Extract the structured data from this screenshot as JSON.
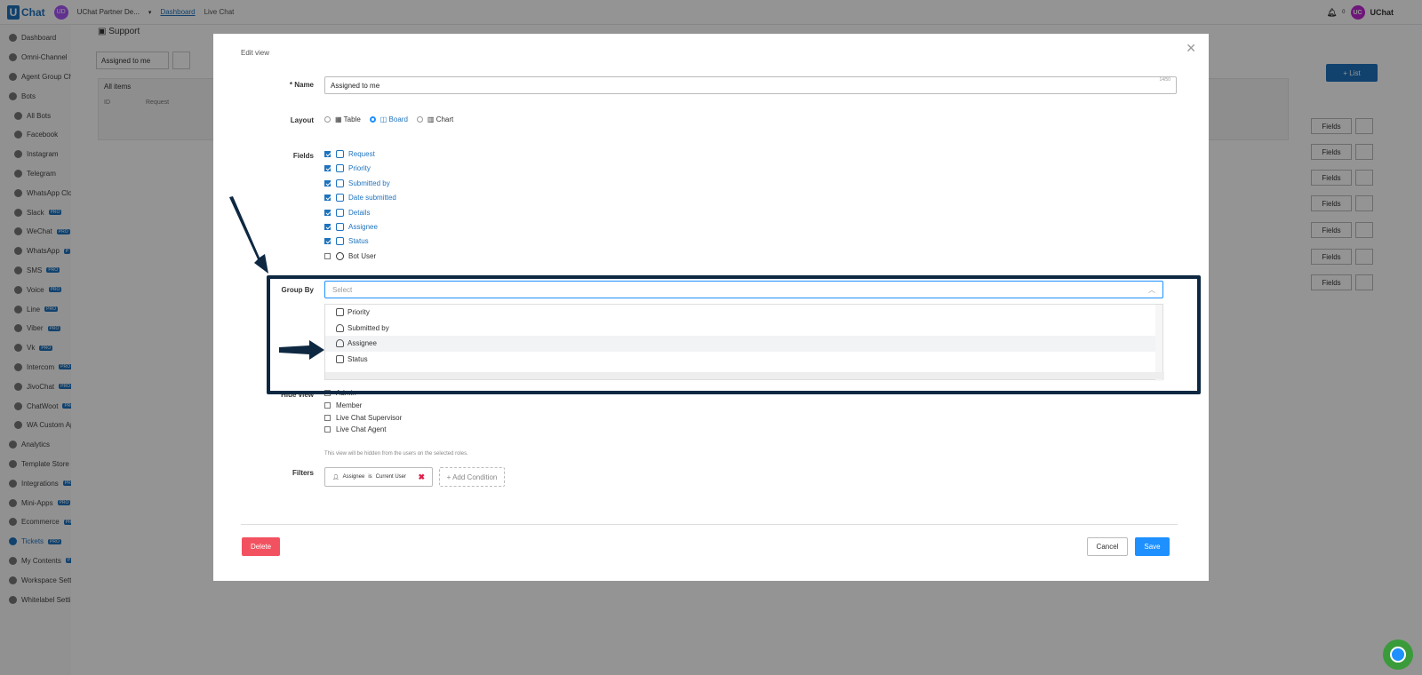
{
  "topbar": {
    "logo_letter": "U",
    "logo_text": "Chat",
    "user_initials": "UD",
    "workspace": "UChat Partner De...",
    "nav_dashboard": "Dashboard",
    "nav_livechat": "Live Chat",
    "notif_count": "0",
    "account_initials": "UC",
    "account_name": "UChat"
  },
  "sidebar": {
    "items": [
      {
        "label": "Dashboard",
        "icon": "dashboard-icon"
      },
      {
        "label": "Omni-Channel",
        "icon": "omnichannel-icon"
      },
      {
        "label": "Agent Group Ch",
        "icon": "agent-group-icon"
      },
      {
        "label": "Bots",
        "icon": "bots-icon"
      },
      {
        "label": "All Bots",
        "icon": "all-bots-icon"
      },
      {
        "label": "Facebook",
        "icon": "facebook-icon"
      },
      {
        "label": "Instagram",
        "icon": "instagram-icon"
      },
      {
        "label": "Telegram",
        "icon": "telegram-icon"
      },
      {
        "label": "WhatsApp Clo",
        "icon": "whatsapp-icon"
      },
      {
        "label": "Slack",
        "icon": "slack-icon",
        "pro": "PRO"
      },
      {
        "label": "WeChat",
        "icon": "wechat-icon",
        "pro": "PRO"
      },
      {
        "label": "WhatsApp",
        "icon": "whatsapp-icon",
        "pro": "P"
      },
      {
        "label": "SMS",
        "icon": "sms-icon",
        "pro": "PRO"
      },
      {
        "label": "Voice",
        "icon": "voice-icon",
        "pro": "PRO"
      },
      {
        "label": "Line",
        "icon": "line-icon",
        "pro": "PRO"
      },
      {
        "label": "Viber",
        "icon": "viber-icon",
        "pro": "PRO"
      },
      {
        "label": "Vk",
        "icon": "vk-icon",
        "pro": "PRO"
      },
      {
        "label": "Intercom",
        "icon": "intercom-icon",
        "pro": "PRO"
      },
      {
        "label": "JivoChat",
        "icon": "jivochat-icon",
        "pro": "PRO"
      },
      {
        "label": "ChatWoot",
        "icon": "chatwoot-icon",
        "pro": "PRO"
      },
      {
        "label": "WA Custom Ap",
        "icon": "wa-custom-icon"
      },
      {
        "label": "Analytics",
        "icon": "analytics-icon"
      },
      {
        "label": "Template Store",
        "icon": "template-store-icon"
      },
      {
        "label": "Integrations",
        "icon": "integrations-icon",
        "pro": "PRO"
      },
      {
        "label": "Mini-Apps",
        "icon": "mini-apps-icon",
        "pro": "PRO"
      },
      {
        "label": "Ecommerce",
        "icon": "ecommerce-icon",
        "pro": "PR"
      },
      {
        "label": "Tickets",
        "icon": "tickets-icon",
        "pro": "PRO",
        "active": true
      },
      {
        "label": "My Contents",
        "icon": "my-contents-icon",
        "pro": "P"
      },
      {
        "label": "Workspace Setti",
        "icon": "workspace-settings-icon"
      },
      {
        "label": "Whitelabel Setti",
        "icon": "whitelabel-settings-icon"
      }
    ]
  },
  "background": {
    "page_title": "Support",
    "view_select": "Assigned to me",
    "all_items": "All items",
    "col_id": "ID",
    "col_request": "Request",
    "list_button": "+ List",
    "fields_button": "Fields"
  },
  "modal": {
    "title": "Edit view",
    "name_label": "* Name",
    "name_value": "Assigned to me",
    "name_counter": "14/50",
    "layout_label": "Layout",
    "layout_options": [
      {
        "label": "Table",
        "selected": false
      },
      {
        "label": "Board",
        "selected": true
      },
      {
        "label": "Chart",
        "selected": false
      }
    ],
    "fields_label": "Fields",
    "fields": [
      {
        "label": "Request",
        "checked": true
      },
      {
        "label": "Priority",
        "checked": true
      },
      {
        "label": "Submitted by",
        "checked": true
      },
      {
        "label": "Date submitted",
        "checked": true
      },
      {
        "label": "Details",
        "checked": true
      },
      {
        "label": "Assignee",
        "checked": true
      },
      {
        "label": "Status",
        "checked": true
      },
      {
        "label": "Bot User",
        "checked": false
      }
    ],
    "groupby_label": "Group By",
    "groupby_placeholder": "Select",
    "groupby_options": [
      {
        "label": "Priority",
        "icon": "dropdown-field-icon"
      },
      {
        "label": "Submitted by",
        "icon": "user-icon"
      },
      {
        "label": "Assignee",
        "icon": "user-icon",
        "hover": true
      },
      {
        "label": "Status",
        "icon": "dropdown-field-icon"
      }
    ],
    "hideview_label": "Hide view",
    "roles": [
      "Admin",
      "Member",
      "Live Chat Supervisor",
      "Live Chat Agent"
    ],
    "hide_hint": "This view will be hidden from the users on the selected roles.",
    "filters_label": "Filters",
    "filter_field": "Assignee",
    "filter_op": "is",
    "filter_value": "Current User",
    "add_condition": "+ Add Condition",
    "delete_button": "Delete",
    "cancel_button": "Cancel",
    "save_button": "Save"
  },
  "colors": {
    "accent": "#1e73be",
    "primary_button": "#1e90ff",
    "danger": "#f25260",
    "highlight_frame": "#0e2842"
  }
}
